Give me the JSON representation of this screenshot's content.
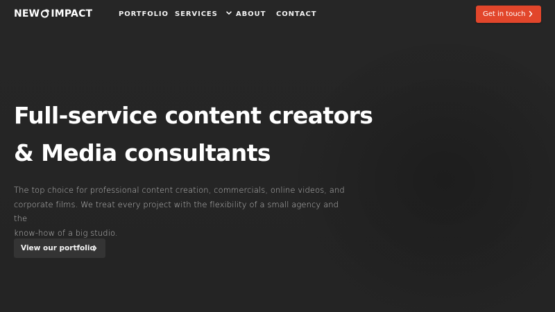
{
  "brand": {
    "name_part1": "NEW",
    "name_part2": "IMPACT",
    "logo_icon": "swirl-o-icon",
    "accent_color": "#e2462b",
    "background_color": "#252525"
  },
  "nav": {
    "items": [
      {
        "label": "PORTFOLIO"
      },
      {
        "label": "SERVICES",
        "has_dropdown": true
      },
      {
        "label": "ABOUT"
      },
      {
        "label": "CONTACT"
      }
    ],
    "cta_label": "Get in touch"
  },
  "hero": {
    "title_line1": "Full-service content creators",
    "title_line2": "& Media consultants",
    "description_line1": "The top choice for professional content creation, commercials, online videos, and",
    "description_line2": "corporate films. We treat every project with the flexibility of a small agency and the",
    "description_line3": "know-how of a big studio.",
    "button_label": "View our portfolio"
  }
}
